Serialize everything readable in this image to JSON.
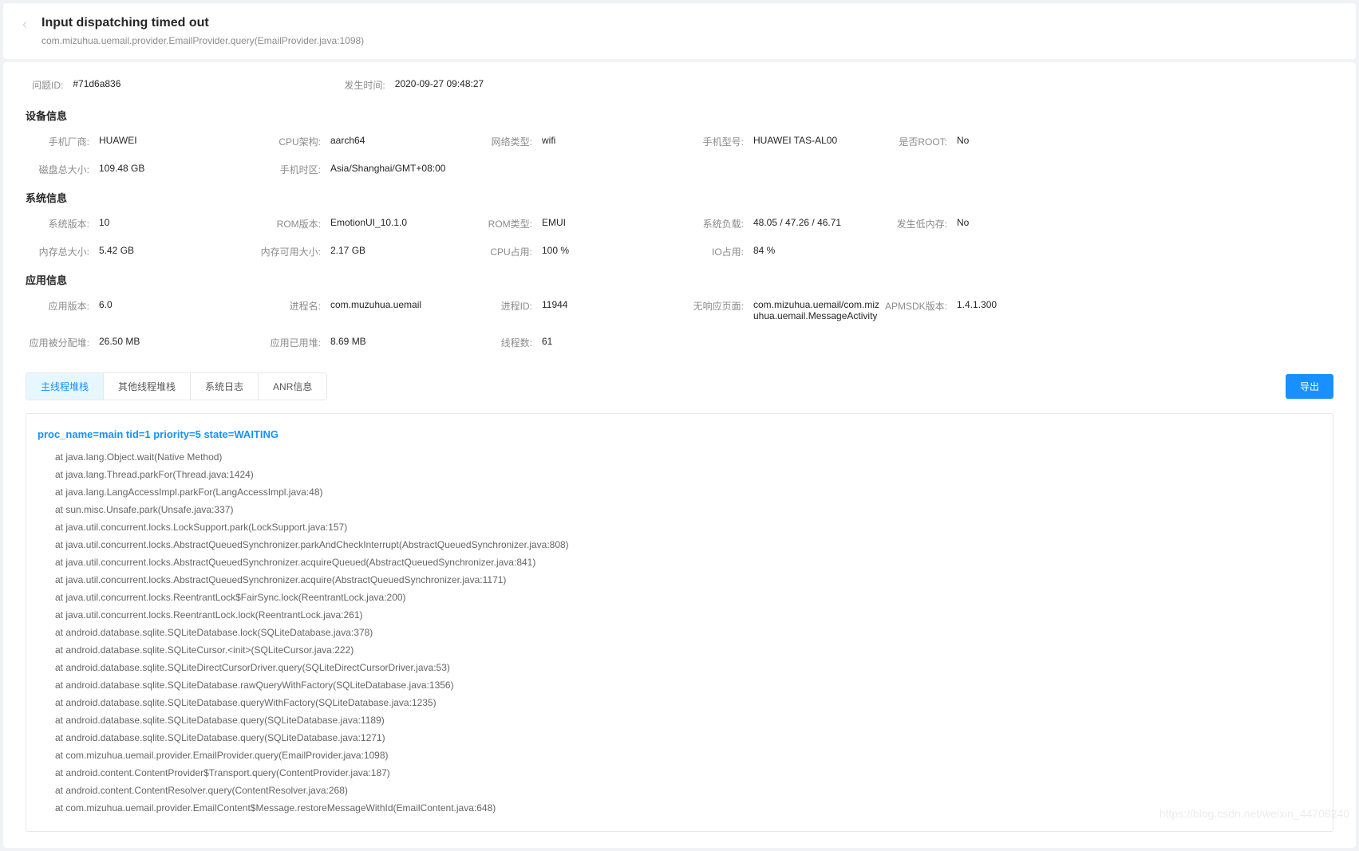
{
  "header": {
    "title": "Input dispatching timed out",
    "subtitle": "com.mizuhua.uemail.provider.EmailProvider.query(EmailProvider.java:1098)"
  },
  "meta": {
    "issue_id_label": "问题ID:",
    "issue_id_value": "#71d6a836",
    "time_label": "发生时间:",
    "time_value": "2020-09-27 09:48:27"
  },
  "sections": {
    "device": {
      "title": "设备信息",
      "rows": [
        [
          {
            "label": "手机厂商:",
            "value": "HUAWEI"
          },
          {
            "label": "CPU架构:",
            "value": "aarch64"
          },
          {
            "label": "网络类型:",
            "value": "wifi"
          },
          {
            "label": "手机型号:",
            "value": "HUAWEI TAS-AL00"
          },
          {
            "label": "是否ROOT:",
            "value": "No"
          }
        ],
        [
          {
            "label": "磁盘总大小:",
            "value": "109.48 GB"
          },
          {
            "label": "手机时区:",
            "value": "Asia/Shanghai/GMT+08:00"
          }
        ]
      ]
    },
    "system": {
      "title": "系统信息",
      "rows": [
        [
          {
            "label": "系统版本:",
            "value": "10"
          },
          {
            "label": "ROM版本:",
            "value": "EmotionUI_10.1.0"
          },
          {
            "label": "ROM类型:",
            "value": "EMUI"
          },
          {
            "label": "系统负载:",
            "value": "48.05 / 47.26 / 46.71"
          },
          {
            "label": "发生低内存:",
            "value": "No"
          }
        ],
        [
          {
            "label": "内存总大小:",
            "value": "5.42 GB"
          },
          {
            "label": "内存可用大小:",
            "value": "2.17 GB"
          },
          {
            "label": "CPU占用:",
            "value": "100 %"
          },
          {
            "label": "IO占用:",
            "value": "84 %"
          }
        ]
      ]
    },
    "app": {
      "title": "应用信息",
      "rows": [
        [
          {
            "label": "应用版本:",
            "value": "6.0"
          },
          {
            "label": "进程名:",
            "value": "com.muzuhua.uemail"
          },
          {
            "label": "进程ID:",
            "value": "11944"
          },
          {
            "label": "无响应页面:",
            "value": "com.mizuhua.uemail/com.mizuhua.uemail.MessageActivity"
          },
          {
            "label": "APMSDK版本:",
            "value": "1.4.1.300"
          }
        ],
        [
          {
            "label": "应用被分配堆:",
            "value": "26.50 MB"
          },
          {
            "label": "应用已用堆:",
            "value": "8.69 MB"
          },
          {
            "label": "线程数:",
            "value": "61"
          }
        ]
      ]
    }
  },
  "tabs": {
    "items": [
      "主线程堆栈",
      "其他线程堆栈",
      "系统日志",
      "ANR信息"
    ],
    "active_index": 0
  },
  "export_label": "导出",
  "stack": {
    "header": "proc_name=main tid=1 priority=5 state=WAITING",
    "lines": [
      "at  java.lang.Object.wait(Native Method)",
      "at  java.lang.Thread.parkFor(Thread.java:1424)",
      "at  java.lang.LangAccessImpl.parkFor(LangAccessImpl.java:48)",
      "at  sun.misc.Unsafe.park(Unsafe.java:337)",
      "at  java.util.concurrent.locks.LockSupport.park(LockSupport.java:157)",
      "at  java.util.concurrent.locks.AbstractQueuedSynchronizer.parkAndCheckInterrupt(AbstractQueuedSynchronizer.java:808)",
      "at  java.util.concurrent.locks.AbstractQueuedSynchronizer.acquireQueued(AbstractQueuedSynchronizer.java:841)",
      "at  java.util.concurrent.locks.AbstractQueuedSynchronizer.acquire(AbstractQueuedSynchronizer.java:1171)",
      "at  java.util.concurrent.locks.ReentrantLock$FairSync.lock(ReentrantLock.java:200)",
      "at  java.util.concurrent.locks.ReentrantLock.lock(ReentrantLock.java:261)",
      "at  android.database.sqlite.SQLiteDatabase.lock(SQLiteDatabase.java:378)",
      "at  android.database.sqlite.SQLiteCursor.<init>(SQLiteCursor.java:222)",
      "at  android.database.sqlite.SQLiteDirectCursorDriver.query(SQLiteDirectCursorDriver.java:53)",
      "at  android.database.sqlite.SQLiteDatabase.rawQueryWithFactory(SQLiteDatabase.java:1356)",
      "at  android.database.sqlite.SQLiteDatabase.queryWithFactory(SQLiteDatabase.java:1235)",
      "at  android.database.sqlite.SQLiteDatabase.query(SQLiteDatabase.java:1189)",
      "at  android.database.sqlite.SQLiteDatabase.query(SQLiteDatabase.java:1271)",
      "at  com.mizuhua.uemail.provider.EmailProvider.query(EmailProvider.java:1098)",
      "at  android.content.ContentProvider$Transport.query(ContentProvider.java:187)",
      "at  android.content.ContentResolver.query(ContentResolver.java:268)",
      "at  com.mizuhua.uemail.provider.EmailContent$Message.restoreMessageWithId(EmailContent.java:648)"
    ]
  },
  "watermark": "https://blog.csdn.net/weixin_44708240"
}
